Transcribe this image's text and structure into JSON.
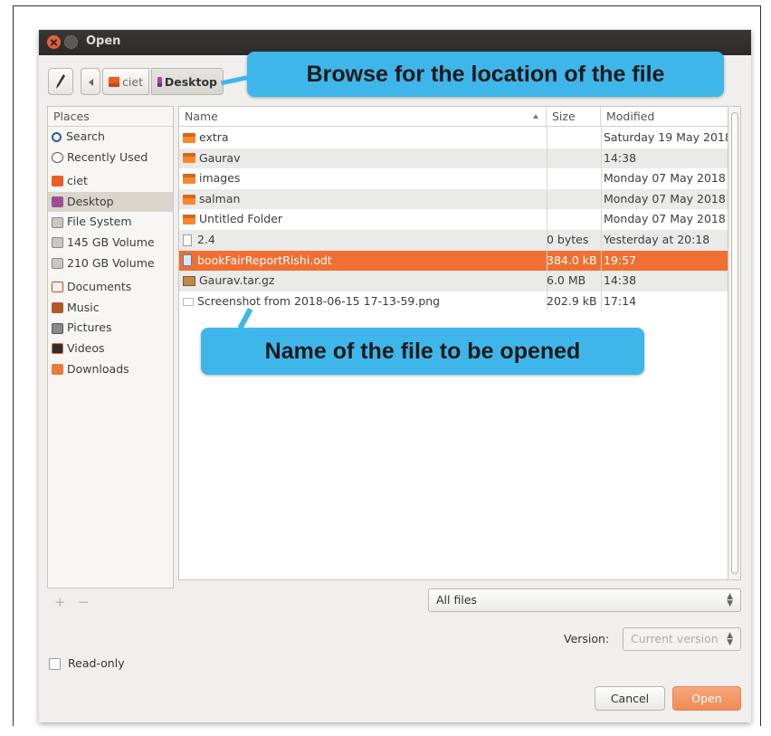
{
  "window": {
    "title": "Open"
  },
  "pathbar": {
    "crumbs": [
      "ciet",
      "Desktop"
    ]
  },
  "callouts": {
    "browse": "Browse for the location of the file",
    "name": "Name of the file  to be opened"
  },
  "places": {
    "header": "Places",
    "items": [
      {
        "label": "Search",
        "icon": "search-icon"
      },
      {
        "label": "Recently Used",
        "icon": "clock-icon"
      },
      {
        "label": "ciet",
        "icon": "home-folder-icon"
      },
      {
        "label": "Desktop",
        "icon": "desktop-icon",
        "active": true
      },
      {
        "label": "File System",
        "icon": "drive-icon"
      },
      {
        "label": "145 GB Volume",
        "icon": "drive-icon"
      },
      {
        "label": "210 GB Volume",
        "icon": "drive-icon"
      },
      {
        "label": "Documents",
        "icon": "documents-icon"
      },
      {
        "label": "Music",
        "icon": "music-icon"
      },
      {
        "label": "Pictures",
        "icon": "pictures-icon"
      },
      {
        "label": "Videos",
        "icon": "videos-icon"
      },
      {
        "label": "Downloads",
        "icon": "downloads-icon"
      }
    ],
    "add_label": "+",
    "remove_label": "−"
  },
  "files": {
    "columns": {
      "name": "Name",
      "size": "Size",
      "modified": "Modified"
    },
    "rows": [
      {
        "name": "extra",
        "size": "",
        "modified": "Saturday 19 May 2018",
        "type": "folder"
      },
      {
        "name": "Gaurav",
        "size": "",
        "modified": "14:38",
        "type": "folder"
      },
      {
        "name": "images",
        "size": "",
        "modified": "Monday 07 May 2018",
        "type": "folder"
      },
      {
        "name": "salman",
        "size": "",
        "modified": "Monday 07 May 2018",
        "type": "folder"
      },
      {
        "name": "Untitled Folder",
        "size": "",
        "modified": "Monday 07 May 2018",
        "type": "folder"
      },
      {
        "name": "2.4",
        "size": "0 bytes",
        "modified": "Yesterday at 20:18",
        "type": "file"
      },
      {
        "name": "bookFairReportRishi.odt",
        "size": "384.0 kB",
        "modified": "19:57",
        "type": "odt",
        "selected": true
      },
      {
        "name": "Gaurav.tar.gz",
        "size": "6.0 MB",
        "modified": "14:38",
        "type": "archive"
      },
      {
        "name": "Screenshot from 2018-06-15 17-13-59.png",
        "size": "202.9 kB",
        "modified": "17:14",
        "type": "image"
      }
    ]
  },
  "filter": {
    "value": "All files"
  },
  "version": {
    "label": "Version:",
    "value": "Current version"
  },
  "readonly": {
    "label": "Read-only",
    "checked": false
  },
  "buttons": {
    "cancel": "Cancel",
    "open": "Open"
  },
  "colors": {
    "accent": "#f06f33",
    "callout": "#3fb6ea",
    "titlebar": "#2c2a28"
  }
}
